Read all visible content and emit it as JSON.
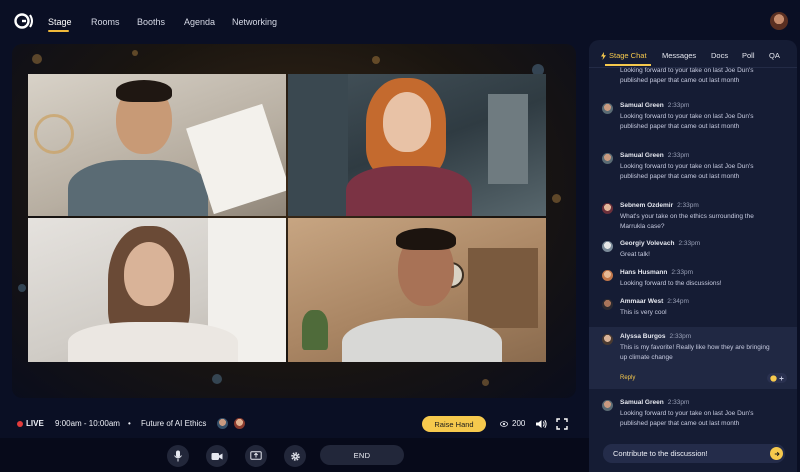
{
  "colors": {
    "accent": "#f6c94d",
    "live": "#e23b3b",
    "background": "#0a0f24",
    "panel": "#151c34"
  },
  "nav": {
    "logo": "logo-icon",
    "items": [
      {
        "label": "Stage",
        "active": true
      },
      {
        "label": "Rooms",
        "active": false
      },
      {
        "label": "Booths",
        "active": false
      },
      {
        "label": "Agenda",
        "active": false
      },
      {
        "label": "Networking",
        "active": false
      }
    ]
  },
  "stage": {
    "live_label": "LIVE",
    "time": "9:00am - 10:00am",
    "separator": "•",
    "session_title": "Future of AI Ethics",
    "raise_hand_label": "Raise Hand",
    "viewer_count": "200"
  },
  "controls": {
    "icons": [
      "mic-icon",
      "camera-icon",
      "screen-share-icon",
      "settings-icon"
    ],
    "end_label": "END"
  },
  "chat": {
    "tabs": [
      {
        "label": "Stage Chat",
        "active": true
      },
      {
        "label": "Messages",
        "active": false
      },
      {
        "label": "Docs",
        "active": false
      },
      {
        "label": "Poll",
        "active": false
      },
      {
        "label": "QA",
        "active": false
      }
    ],
    "partial_top": {
      "text": "Looking forward to your take on last Joe Dun's published paper that came out last month"
    },
    "messages": [
      {
        "name": "Samual Green",
        "time": "2:33pm",
        "text": "Looking forward to your take on last Joe Dun's published paper that came out last month"
      },
      {
        "name": "Samual Green",
        "time": "2:33pm",
        "text": "Looking forward to your take on last Joe Dun's published paper that came out last month"
      },
      {
        "name": "Sebnem Ozdemir",
        "time": "2:33pm",
        "text": "What's your take on the ethics surrounding the Marrukla case?"
      },
      {
        "name": "Georgiy Volevach",
        "time": "2:33pm",
        "text": "Great talk!"
      },
      {
        "name": "Hans Husmann",
        "time": "2:33pm",
        "text": "Looking forward to the discussions!"
      },
      {
        "name": "Ammaar West",
        "time": "2:34pm",
        "text": "This is very cool"
      },
      {
        "name": "Alyssa Burgos",
        "time": "2:33pm",
        "text": "This is my favorite! Really like how they are bringing up climate change",
        "reply_label": "Reply"
      },
      {
        "name": "Samual Green",
        "time": "2:33pm",
        "text": "Looking forward to your take on last Joe Dun's published paper that came out last month"
      }
    ],
    "input_placeholder": "Contribute to the discussion!"
  }
}
